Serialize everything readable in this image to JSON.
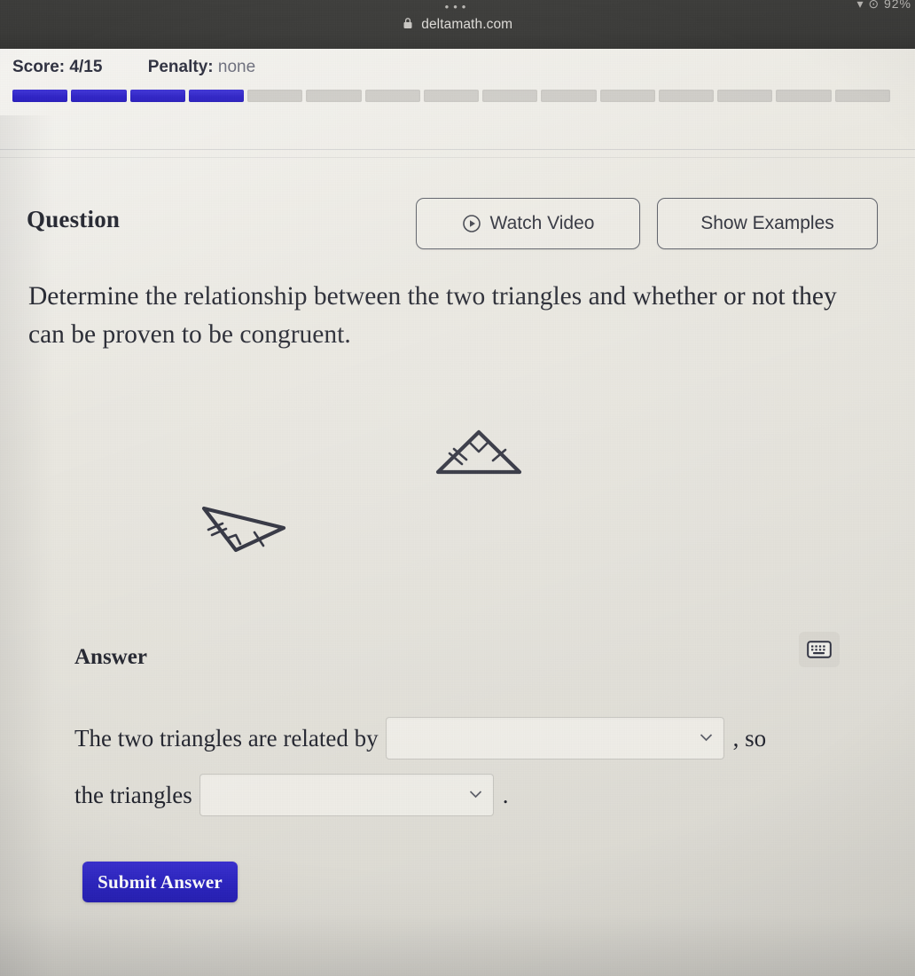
{
  "browser": {
    "menu_dots": "•••",
    "lock_icon": "lock-icon",
    "url": "deltamath.com",
    "status_right": "▾ ⊙ 92%"
  },
  "progress": {
    "score_label": "Score:",
    "score_value": "4/15",
    "penalty_label": "Penalty:",
    "penalty_value": "none",
    "total_segments": 15,
    "filled_segments": 4,
    "filled_color": "#2f23c6",
    "empty_color": "#cfcdc8"
  },
  "question": {
    "heading": "Question",
    "watch_video_label": "Watch Video",
    "watch_video_icon": "play-circle-icon",
    "show_examples_label": "Show Examples",
    "prompt": "Determine the relationship between the two triangles and whether or not they can be proven to be congruent."
  },
  "figure": {
    "alt": "two-triangles-figure",
    "triangles": [
      {
        "name": "upper-triangle",
        "right_angle_at": "apex",
        "left_side_ticks": 2,
        "right_side_ticks": 1
      },
      {
        "name": "lower-triangle",
        "right_angle_at": "bottom-vertex",
        "left_side_ticks": 2,
        "right_side_ticks": 1
      }
    ],
    "stroke_color": "#2b2d3a"
  },
  "answer": {
    "heading": "Answer",
    "keypad_icon": "keyboard-icon",
    "row1_prefix": "The two triangles are related by",
    "row1_select_value": "",
    "row1_select_placeholder": "",
    "row1_suffix": ", so",
    "row2_prefix": "the triangles",
    "row2_select_value": "",
    "row2_select_placeholder": "",
    "row2_suffix": ".",
    "chevron_icon": "chevron-down-icon",
    "submit_label": "Submit Answer",
    "submit_color": "#2b24c0"
  }
}
